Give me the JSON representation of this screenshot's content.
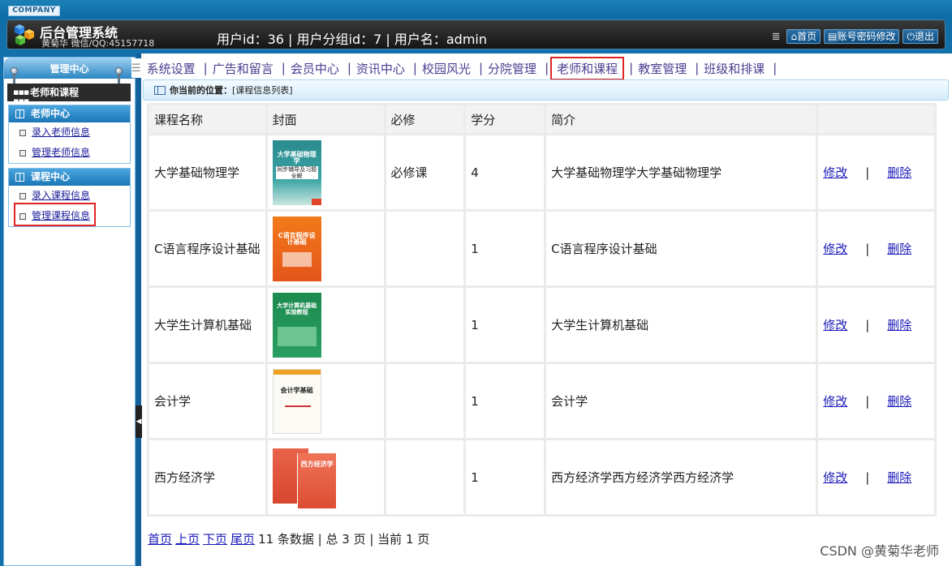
{
  "header": {
    "company": "COMPANY",
    "title": "后台管理系统",
    "subtitle": "黄菊华 微信/QQ:45157718",
    "user_info": "用户id：36 | 用户分组id：7 | 用户名：admin",
    "btn_home": "首页",
    "btn_password": "账号密码修改",
    "btn_logout": "退出"
  },
  "sidebar": {
    "title": "管理中心",
    "current": "老师和课程",
    "groups": [
      {
        "title": "老师中心",
        "items": [
          "录入老师信息",
          "管理老师信息"
        ]
      },
      {
        "title": "课程中心",
        "items": [
          "录入课程信息",
          "管理课程信息"
        ]
      }
    ]
  },
  "nav": {
    "items": [
      "系统设置",
      "广告和留言",
      "会员中心",
      "资讯中心",
      "校园风光",
      "分院管理",
      "老师和课程",
      "教室管理",
      "班级和排课"
    ],
    "active": "老师和课程"
  },
  "breadcrumb": {
    "label": "你当前的位置：",
    "path": "[课程信息列表]"
  },
  "table": {
    "headers": [
      "课程名称",
      "封面",
      "必修",
      "学分",
      "简介",
      ""
    ],
    "rows": [
      {
        "name": "大学基础物理学",
        "required": "必修课",
        "credit": "4",
        "intro": "大学基础物理学大学基础物理学",
        "cover_text": "大学基础物理学",
        "cover_sub": "同步辅导及习题全解"
      },
      {
        "name": "C语言程序设计基础",
        "required": "",
        "credit": "1",
        "intro": "C语言程序设计基础",
        "cover_text": "C语言程序设计基础",
        "cover_sub": ""
      },
      {
        "name": "大学生计算机基础",
        "required": "",
        "credit": "1",
        "intro": "大学生计算机基础",
        "cover_text": "大学计算机基础实验教程",
        "cover_sub": ""
      },
      {
        "name": "会计学",
        "required": "",
        "credit": "1",
        "intro": "会计学",
        "cover_text": "会计学基础",
        "cover_sub": ""
      },
      {
        "name": "西方经济学",
        "required": "",
        "credit": "1",
        "intro": "西方经济学西方经济学西方经济学",
        "cover_text": "西方经济学",
        "cover_sub": ""
      }
    ],
    "edit_label": "修改",
    "delete_label": "删除",
    "separator": "|"
  },
  "pager": {
    "first": "首页",
    "prev": "上页",
    "next": "下页",
    "last": "尾页",
    "summary": "11 条数据 | 总 3 页 | 当前 1 页"
  },
  "watermark": "CSDN @黄菊华老师",
  "colors": {
    "header_blue": "#1372ab",
    "link": "#1a1ab8",
    "highlight_red": "#e02424"
  }
}
